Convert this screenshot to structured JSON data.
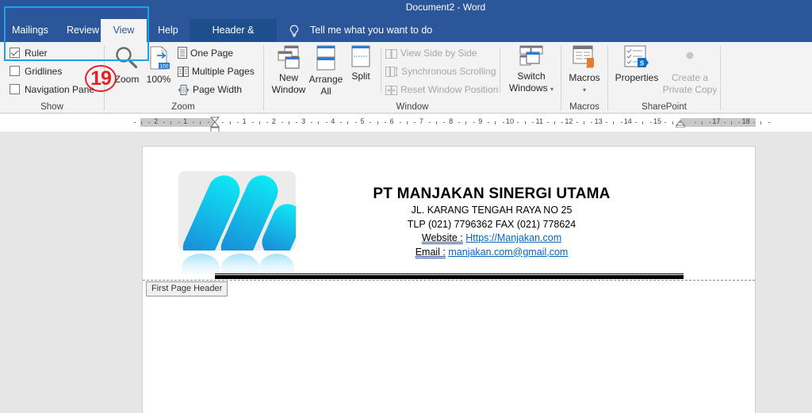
{
  "window": {
    "title": "Document2  -  Word"
  },
  "tabs": [
    {
      "label": "Mailings",
      "active": false
    },
    {
      "label": "Review",
      "active": false
    },
    {
      "label": "View",
      "active": true
    },
    {
      "label": "Help",
      "active": false
    },
    {
      "label": "Header & Footer",
      "active": false,
      "contextual": true
    }
  ],
  "tell_me": {
    "placeholder": "Tell me what you want to do",
    "icon": "lightbulb-icon"
  },
  "ribbon": {
    "show": {
      "label": "Show",
      "checkboxes": [
        {
          "label": "Ruler",
          "checked": true
        },
        {
          "label": "Gridlines",
          "checked": false
        },
        {
          "label": "Navigation Pane",
          "checked": false
        }
      ]
    },
    "zoom": {
      "label": "Zoom",
      "zoom_button": {
        "label": "Zoom",
        "icon": "magnifier-icon"
      },
      "hundred_button": {
        "label": "100%",
        "icon_badge": "100",
        "icon": "zoom-100-icon"
      },
      "one_page": {
        "label": "One Page",
        "icon": "one-page-icon"
      },
      "multiple_pages": {
        "label": "Multiple Pages",
        "icon": "multiple-pages-icon"
      },
      "page_width": {
        "label": "Page Width",
        "icon": "page-width-icon"
      }
    },
    "window": {
      "label": "Window",
      "new_window": {
        "line1": "New",
        "line2": "Window"
      },
      "arrange_all": {
        "line1": "Arrange",
        "line2": "All"
      },
      "split": {
        "label": "Split"
      },
      "view_side_by_side": {
        "label": "View Side by Side",
        "enabled": false
      },
      "synchronous_scrolling": {
        "label": "Synchronous Scrolling",
        "enabled": false
      },
      "reset_window_position": {
        "label": "Reset Window Position",
        "enabled": false
      },
      "switch_windows": {
        "line1": "Switch",
        "line2": "Windows",
        "dropdown": "▾"
      }
    },
    "macros": {
      "label": "Macros",
      "macros_button": {
        "label": "Macros",
        "dropdown": "▾"
      }
    },
    "sharepoint": {
      "label": "SharePoint",
      "properties": {
        "label": "Properties",
        "badge": "S"
      },
      "create_private_copy": {
        "line1": "Create a",
        "line2": "Private Copy",
        "enabled": false
      }
    }
  },
  "ruler": {
    "unit": "cm",
    "left_labels": [
      "2",
      "1"
    ],
    "right_labels": [
      "1",
      "2",
      "3",
      "4",
      "5",
      "6",
      "7",
      "8",
      "9",
      "10",
      "11",
      "12",
      "13",
      "14",
      "15",
      "17",
      "18"
    ]
  },
  "document": {
    "header": {
      "company_name": "PT MANJAKAN SINERGI UTAMA",
      "address": "JL. KARANG TENGAH RAYA NO 25",
      "phone_fax": "TLP (021) 7796362 FAX (021) 778624",
      "website_label": "Website :",
      "website_value": "Https://Manjakan.com",
      "email_label": "Email :",
      "email_value": "manjakan.com@gmail,com",
      "logo": "company-logo-m"
    },
    "header_tag": "First Page Header"
  },
  "annotation": {
    "step_number": "19",
    "highlight_color": "#1aa3e8",
    "badge_color": "#e02424"
  },
  "colors": {
    "word_blue": "#2b579a",
    "ribbon_bg": "#f3f3f3",
    "link": "#0563c1",
    "logo_gradient_top": "#0ee8f5",
    "logo_gradient_bottom": "#1a86d6"
  }
}
